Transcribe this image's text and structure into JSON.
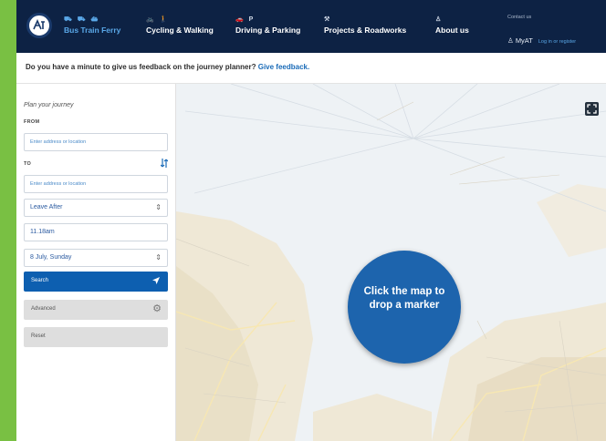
{
  "nav": {
    "bus": {
      "label": "Bus Train Ferry",
      "glyphs": "⛟ ⛟ ⛴"
    },
    "cycling": {
      "label": "Cycling & Walking",
      "glyphs": "🚲 🚶"
    },
    "driving": {
      "label": "Driving & Parking",
      "glyphs": "🚗 P"
    },
    "projects": {
      "label": "Projects & Roadworks",
      "glyphs": "⚒"
    },
    "about": {
      "label": "About us",
      "glyphs": "♙"
    },
    "contact": "Contact us",
    "myat": "MyAT",
    "login": "Log in or register"
  },
  "feedback": {
    "text": "Do you have a minute to give us feedback on the journey planner?",
    "link": "Give feedback."
  },
  "planner": {
    "title": "Plan your journey",
    "from_label": "FROM",
    "from_placeholder": "Enter address or location",
    "to_label": "TO",
    "to_placeholder": "Enter address or location",
    "leave": "Leave After",
    "time": "11.18am",
    "date": "8 July, Sunday",
    "search": "Search",
    "advanced": "Advanced",
    "reset": "Reset"
  },
  "map": {
    "marker_text": "Click the map to drop a marker"
  },
  "colors": {
    "nav_bg": "#0d2244",
    "accent": "#1d64ad",
    "frame": "#79c043"
  }
}
